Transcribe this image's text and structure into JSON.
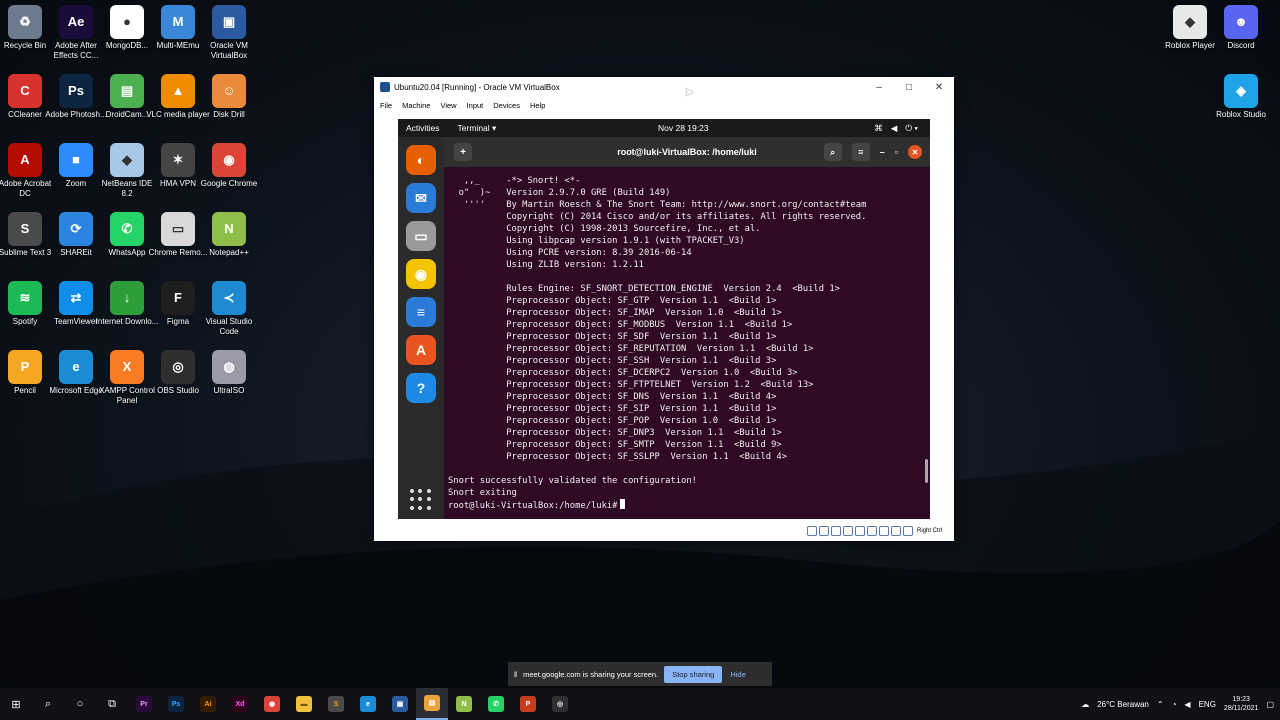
{
  "desktop": {
    "left_icons": [
      {
        "label": "Recycle Bin",
        "icon": "recycle-bin-icon",
        "color": "#6b7a8c",
        "glyph": "♻"
      },
      {
        "label": "Adobe After Effects CC...",
        "icon": "after-effects-icon",
        "color": "#1a0b3a",
        "glyph": "Ae"
      },
      {
        "label": "MongoDB...",
        "icon": "mongodb-icon",
        "color": "#ffffff",
        "glyph": "●"
      },
      {
        "label": "Multi-MEmu",
        "icon": "memu-icon",
        "color": "#3a86d9",
        "glyph": "M"
      },
      {
        "label": "Oracle VM VirtualBox",
        "icon": "virtualbox-icon",
        "color": "#2b5aa0",
        "glyph": "▣"
      },
      {
        "label": "CCleaner",
        "icon": "ccleaner-icon",
        "color": "#d6322e",
        "glyph": "C"
      },
      {
        "label": "Adobe Photosh...",
        "icon": "photoshop-icon",
        "color": "#0b2540",
        "glyph": "Ps"
      },
      {
        "label": "DroidCam...",
        "icon": "droidcam-icon",
        "color": "#4caf50",
        "glyph": "▤"
      },
      {
        "label": "VLC media player",
        "icon": "vlc-icon",
        "color": "#f08c00",
        "glyph": "▲"
      },
      {
        "label": "Disk Drill",
        "icon": "disk-drill-icon",
        "color": "#e98b3a",
        "glyph": "☺"
      },
      {
        "label": "Adobe Acrobat DC",
        "icon": "acrobat-icon",
        "color": "#b30b00",
        "glyph": "A"
      },
      {
        "label": "Zoom",
        "icon": "zoom-icon",
        "color": "#2d8cff",
        "glyph": "■"
      },
      {
        "label": "NetBeans IDE 8.2",
        "icon": "netbeans-icon",
        "color": "#a8c8e8",
        "glyph": "◆"
      },
      {
        "label": "HMA VPN",
        "icon": "hma-vpn-icon",
        "color": "#444444",
        "glyph": "✶"
      },
      {
        "label": "Google Chrome",
        "icon": "chrome-icon",
        "color": "#db4437",
        "glyph": "◉"
      },
      {
        "label": "Sublime Text 3",
        "icon": "sublime-icon",
        "color": "#4a4a4a",
        "glyph": "S"
      },
      {
        "label": "SHAREit",
        "icon": "shareit-icon",
        "color": "#2a84e0",
        "glyph": "⟳"
      },
      {
        "label": "WhatsApp",
        "icon": "whatsapp-icon",
        "color": "#25d366",
        "glyph": "✆"
      },
      {
        "label": "Chrome Remo...",
        "icon": "chrome-remote-icon",
        "color": "#d9d9d9",
        "glyph": "▭"
      },
      {
        "label": "Notepad++",
        "icon": "notepadpp-icon",
        "color": "#8fbf4a",
        "glyph": "N"
      },
      {
        "label": "Spotify",
        "icon": "spotify-icon",
        "color": "#1db954",
        "glyph": "≋"
      },
      {
        "label": "TeamViewer",
        "icon": "teamviewer-icon",
        "color": "#0e8ee9",
        "glyph": "⇄"
      },
      {
        "label": "Internet Downlo...",
        "icon": "idm-icon",
        "color": "#2e9e3a",
        "glyph": "↓"
      },
      {
        "label": "Figma",
        "icon": "figma-icon",
        "color": "#1e1e1e",
        "glyph": "F"
      },
      {
        "label": "Visual Studio Code",
        "icon": "vscode-icon",
        "color": "#1f8ad2",
        "glyph": "≺"
      },
      {
        "label": "Pencil",
        "icon": "pencil-icon",
        "color": "#f5a623",
        "glyph": "P"
      },
      {
        "label": "Microsoft Edge",
        "icon": "edge-icon",
        "color": "#1b8bd6",
        "glyph": "e"
      },
      {
        "label": "XAMPP Control Panel",
        "icon": "xampp-icon",
        "color": "#fb7a24",
        "glyph": "X"
      },
      {
        "label": "OBS Studio",
        "icon": "obs-icon",
        "color": "#2e2e2e",
        "glyph": "◎"
      },
      {
        "label": "UltraISO",
        "icon": "ultraiso-icon",
        "color": "#9a9aa8",
        "glyph": "◍"
      }
    ],
    "right_icons": [
      {
        "label": "Roblox Player",
        "icon": "roblox-icon",
        "color": "#e8e8e8",
        "glyph": "◆"
      },
      {
        "label": "Discord",
        "icon": "discord-icon",
        "color": "#5865f2",
        "glyph": "☻"
      },
      {
        "label": "Roblox Studio",
        "icon": "roblox-studio-icon",
        "color": "#1fa3e8",
        "glyph": "◈"
      }
    ]
  },
  "vbox": {
    "title": "Ubuntu20.04 [Running] - Oracle VM VirtualBox",
    "menu": [
      "File",
      "Machine",
      "View",
      "Input",
      "Devices",
      "Help"
    ],
    "status_right": "Right Ctrl"
  },
  "ubuntu": {
    "activities": "Activities",
    "app_menu": "Terminal ▾",
    "clock": "Nov 28  19:23",
    "terminal_title": "root@luki-VirtualBox: /home/luki",
    "dock": [
      {
        "icon": "firefox-icon",
        "color": "#e66000",
        "glyph": "◐"
      },
      {
        "icon": "thunderbird-icon",
        "color": "#2a7bd8",
        "glyph": "✉"
      },
      {
        "icon": "files-icon",
        "color": "#9a9a9a",
        "glyph": "▭"
      },
      {
        "icon": "rhythmbox-icon",
        "color": "#f5c400",
        "glyph": "◉"
      },
      {
        "icon": "libreoffice-writer-icon",
        "color": "#2a7ad8",
        "glyph": "≡"
      },
      {
        "icon": "software-center-icon",
        "color": "#e95420",
        "glyph": "A"
      },
      {
        "icon": "help-icon",
        "color": "#1e88e5",
        "glyph": "?"
      }
    ],
    "terminal_lines": [
      "   ,,_     -*> Snort! <*-",
      "  o\"  )~   Version 2.9.7.0 GRE (Build 149)",
      "   ''''    By Martin Roesch & The Snort Team: http://www.snort.org/contact#team",
      "           Copyright (C) 2014 Cisco and/or its affiliates. All rights reserved.",
      "           Copyright (C) 1998-2013 Sourcefire, Inc., et al.",
      "           Using libpcap version 1.9.1 (with TPACKET_V3)",
      "           Using PCRE version: 8.39 2016-06-14",
      "           Using ZLIB version: 1.2.11",
      "",
      "           Rules Engine: SF_SNORT_DETECTION_ENGINE  Version 2.4  <Build 1>",
      "           Preprocessor Object: SF_GTP  Version 1.1  <Build 1>",
      "           Preprocessor Object: SF_IMAP  Version 1.0  <Build 1>",
      "           Preprocessor Object: SF_MODBUS  Version 1.1  <Build 1>",
      "           Preprocessor Object: SF_SDF  Version 1.1  <Build 1>",
      "           Preprocessor Object: SF_REPUTATION  Version 1.1  <Build 1>",
      "           Preprocessor Object: SF_SSH  Version 1.1  <Build 3>",
      "           Preprocessor Object: SF_DCERPC2  Version 1.0  <Build 3>",
      "           Preprocessor Object: SF_FTPTELNET  Version 1.2  <Build 13>",
      "           Preprocessor Object: SF_DNS  Version 1.1  <Build 4>",
      "           Preprocessor Object: SF_SIP  Version 1.1  <Build 1>",
      "           Preprocessor Object: SF_POP  Version 1.0  <Build 1>",
      "           Preprocessor Object: SF_DNP3  Version 1.1  <Build 1>",
      "           Preprocessor Object: SF_SMTP  Version 1.1  <Build 9>",
      "           Preprocessor Object: SF_SSLPP  Version 1.1  <Build 4>",
      "",
      "Snort successfully validated the configuration!",
      "Snort exiting",
      "root@luki-VirtualBox:/home/luki#"
    ]
  },
  "share_bar": {
    "message": "meet.google.com is sharing your screen.",
    "stop": "Stop sharing",
    "hide": "Hide"
  },
  "taskbar": {
    "weather": "26°C  Berawan",
    "lang": "ENG",
    "time": "19:23",
    "date": "28/11/2021",
    "apps": [
      {
        "icon": "premiere-icon",
        "color": "#2a0a3a",
        "glyph": "Pr",
        "text": "#e79ff7"
      },
      {
        "icon": "photoshop-taskbar-icon",
        "color": "#0b2540",
        "glyph": "Ps",
        "text": "#31a8ff"
      },
      {
        "icon": "illustrator-icon",
        "color": "#331c00",
        "glyph": "Ai",
        "text": "#ff9a00"
      },
      {
        "icon": "xd-icon",
        "color": "#2e001e",
        "glyph": "Xd",
        "text": "#ff61f6"
      },
      {
        "icon": "chrome-taskbar-icon",
        "color": "#db4437",
        "glyph": "◉",
        "text": "#ffffff"
      },
      {
        "icon": "file-explorer-icon",
        "color": "#f3c23c",
        "glyph": "▬",
        "text": "#7a5a00"
      },
      {
        "icon": "sublime-taskbar-icon",
        "color": "#4a4a4a",
        "glyph": "S",
        "text": "#ff9800"
      },
      {
        "icon": "edge-taskbar-icon",
        "color": "#1b8bd6",
        "glyph": "e",
        "text": "#ffffff"
      },
      {
        "icon": "virtualbox-taskbar-icon",
        "color": "#2b5aa0",
        "glyph": "▣",
        "text": "#ffffff"
      },
      {
        "icon": "ubuntu-vm-taskbar-icon",
        "color": "#e8a33a",
        "glyph": "▤",
        "text": "#ffffff"
      },
      {
        "icon": "notepad-taskbar-icon",
        "color": "#8fbf4a",
        "glyph": "N",
        "text": "#ffffff"
      },
      {
        "icon": "whatsapp-taskbar-icon",
        "color": "#25d366",
        "glyph": "✆",
        "text": "#ffffff"
      },
      {
        "icon": "powerpoint-icon",
        "color": "#c43e1c",
        "glyph": "P",
        "text": "#ffffff"
      },
      {
        "icon": "obs-taskbar-icon",
        "color": "#2e2e2e",
        "glyph": "◎",
        "text": "#ffffff"
      }
    ]
  }
}
